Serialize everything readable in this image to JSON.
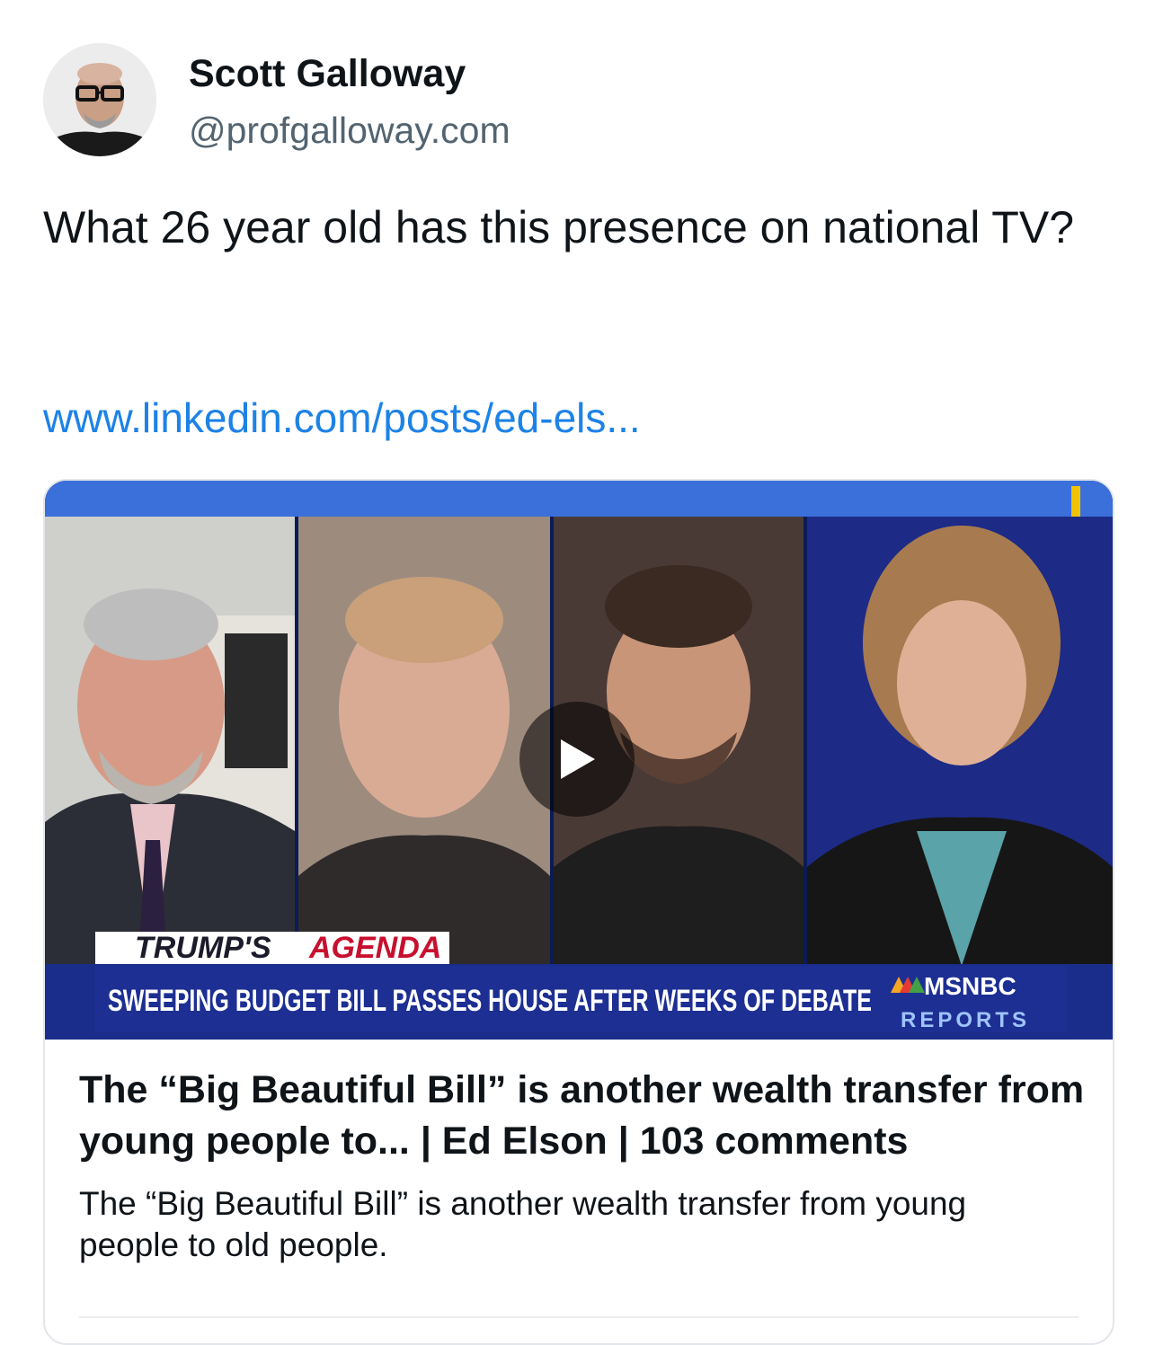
{
  "author": {
    "name": "Scott Galloway",
    "handle": "@profgalloway.com"
  },
  "post": {
    "text": "What 26 year old has this presence on national TV?",
    "link": "www.linkedin.com/posts/ed-els..."
  },
  "media": {
    "segment_tag_a": "TRUMP'S",
    "segment_tag_b": "AGENDA",
    "headline": "SWEEPING BUDGET BILL PASSES HOUSE AFTER WEEKS OF DEBATE",
    "network": "MSNBC",
    "network_sub": "REPORTS",
    "play_icon": "play-icon"
  },
  "card": {
    "title": "The “Big Beautiful Bill” is another wealth transfer from young people to... | Ed Elson | 103 comments",
    "description": "The “Big Beautiful Bill” is another wealth transfer from young people to old people."
  },
  "colors": {
    "link": "#1d82e6",
    "handle": "#536471",
    "lower_third_blue": "#1b2d8a",
    "banner_blue": "#3b6fd9"
  }
}
